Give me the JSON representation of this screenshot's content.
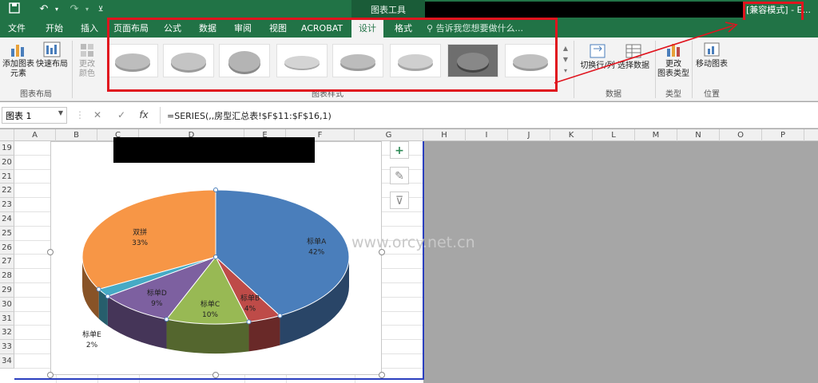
{
  "qat": {
    "save_icon": "save-icon",
    "undo_icon": "undo-icon",
    "redo_icon": "redo-icon",
    "customize_icon": "customize-icon"
  },
  "contextual_group": "图表工具",
  "window_title": "[兼容模式] - E...",
  "tabs": [
    "文件",
    "开始",
    "插入",
    "页面布局",
    "公式",
    "数据",
    "审阅",
    "视图",
    "ACROBAT",
    "设计",
    "格式"
  ],
  "active_tab": "设计",
  "tell_me": "告诉我您想要做什么...",
  "ribbon": {
    "add_element": "添加图表\n元素",
    "quick_layout": "快速布局",
    "change_colors": "更改\n颜色",
    "layout_group": "图表布局",
    "styles_group": "图表样式",
    "switch_row_col": "切换行/列",
    "select_data": "选择数据",
    "data_group": "数据",
    "change_type": "更改\n图表类型",
    "type_group": "类型",
    "move_chart": "移动图表",
    "location_group": "位置"
  },
  "name_box": "图表 1",
  "formula": "=SERIES(,,房型汇总表!$F$11:$F$16,1)",
  "columns": [
    "A",
    "B",
    "C",
    "D",
    "E",
    "F",
    "G",
    "H",
    "I",
    "J",
    "K",
    "L",
    "M",
    "N",
    "O",
    "P"
  ],
  "rows": [
    "19",
    "20",
    "21",
    "22",
    "23",
    "24",
    "25",
    "26",
    "27",
    "28",
    "29",
    "30",
    "31",
    "32",
    "33",
    "34"
  ],
  "watermark": "www.orcy.net.cn",
  "chart_data": {
    "type": "pie",
    "categories": [
      "标单A",
      "标单B",
      "标单C",
      "标单D",
      "标单E",
      "双拼"
    ],
    "values": [
      42,
      4,
      10,
      9,
      2,
      33
    ],
    "labels": [
      "42%",
      "4%",
      "10%",
      "9%",
      "2%",
      "33%"
    ],
    "colors": [
      "#4a7ebb",
      "#be4b48",
      "#98b954",
      "#7d60a0",
      "#46aac5",
      "#f79646"
    ]
  }
}
